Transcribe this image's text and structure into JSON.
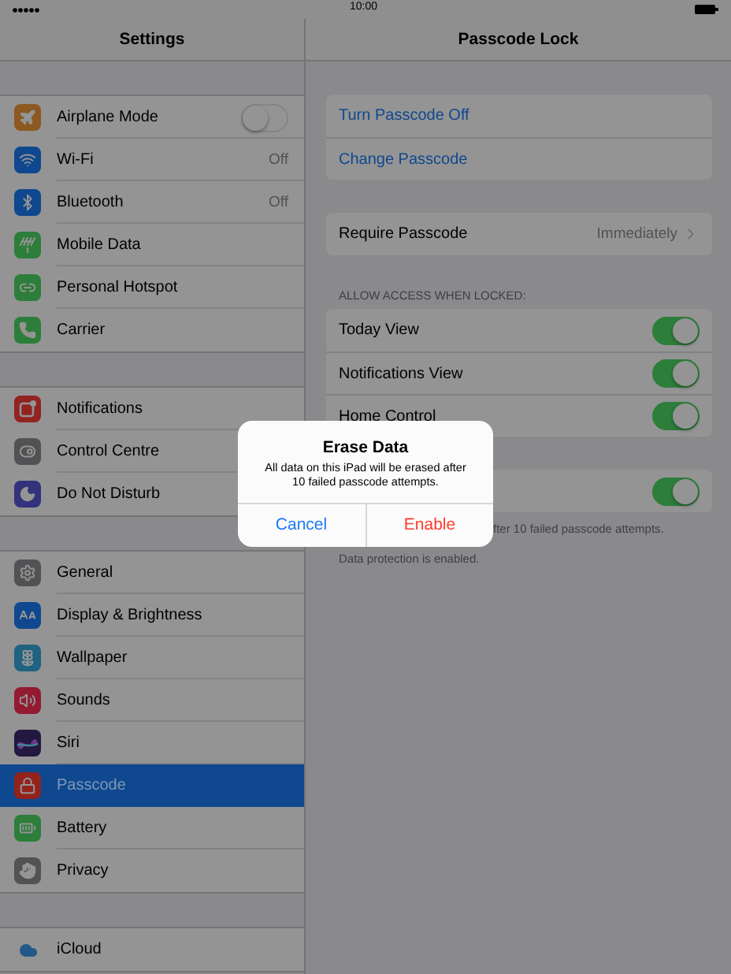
{
  "status_bar": {
    "time": "10:00"
  },
  "sidebar": {
    "title": "Settings",
    "groups": [
      {
        "items": [
          {
            "label": "Airplane Mode",
            "color": "#8c5920",
            "selected": false,
            "kind": "toggle",
            "on": false
          },
          {
            "label": "Wi-Fi",
            "color": "#0f488e",
            "selected": false,
            "kind": "value",
            "value": "Off"
          },
          {
            "label": "Bluetooth",
            "color": "#0f488e",
            "selected": false,
            "kind": "value",
            "value": "Off"
          },
          {
            "label": "Mobile Data",
            "color": "#2c7e3a",
            "selected": false,
            "kind": "plain"
          },
          {
            "label": "Personal Hotspot",
            "color": "#2c7e3a",
            "selected": false,
            "kind": "plain"
          },
          {
            "label": "Carrier",
            "color": "#2c7e3a",
            "selected": false,
            "kind": "plain"
          }
        ]
      },
      {
        "items": [
          {
            "label": "Notifications",
            "color": "#922321",
            "selected": false,
            "kind": "plain"
          },
          {
            "label": "Control Centre",
            "color": "#525255",
            "selected": false,
            "kind": "plain"
          },
          {
            "label": "Do Not Disturb",
            "color": "#33327c",
            "selected": false,
            "kind": "plain"
          }
        ]
      },
      {
        "items": [
          {
            "label": "General",
            "color": "#525255",
            "selected": false,
            "kind": "plain"
          },
          {
            "label": "Display & Brightness",
            "color": "#0f488e",
            "selected": false,
            "kind": "plain"
          },
          {
            "label": "Wallpaper",
            "color": "#1f6380",
            "selected": false,
            "kind": "plain"
          },
          {
            "label": "Sounds",
            "color": "#941a31",
            "selected": false,
            "kind": "plain"
          },
          {
            "label": "Siri",
            "color": "#221840",
            "selected": false,
            "kind": "plain"
          },
          {
            "label": "Passcode",
            "color": "#94221c",
            "selected": true,
            "kind": "plain"
          },
          {
            "label": "Battery",
            "color": "#2c7e3a",
            "selected": false,
            "kind": "plain"
          },
          {
            "label": "Privacy",
            "color": "#525255",
            "selected": false,
            "kind": "plain"
          }
        ]
      },
      {
        "items": [
          {
            "label": "iCloud",
            "color": "#949494",
            "selected": false,
            "kind": "plain"
          }
        ]
      }
    ]
  },
  "detail": {
    "title": "Passcode Lock",
    "sections": [
      {
        "rows": [
          {
            "kind": "link",
            "label": "Turn Passcode Off"
          },
          {
            "kind": "link",
            "label": "Change Passcode"
          }
        ]
      },
      {
        "rows": [
          {
            "kind": "value",
            "label": "Require Passcode",
            "value": "Immediately"
          }
        ]
      },
      {
        "header": "ALLOW ACCESS WHEN LOCKED:",
        "rows": [
          {
            "kind": "toggle",
            "label": "Today View",
            "on": true
          },
          {
            "kind": "toggle",
            "label": "Notifications View",
            "on": true
          },
          {
            "kind": "toggle",
            "label": "Home Control",
            "on": true
          }
        ]
      },
      {
        "rows": [
          {
            "kind": "toggle",
            "on": true
          }
        ],
        "footer_partial": "fter 10 failed passcode attempts.",
        "footer": "Data protection is enabled."
      }
    ]
  },
  "dialog": {
    "title": "Erase Data",
    "message": "All data on this iPad will be erased after 10 failed passcode attempts.",
    "buttons": [
      {
        "label": "Cancel",
        "kind": "cancel"
      },
      {
        "label": "Enable",
        "kind": "destructive"
      }
    ]
  }
}
